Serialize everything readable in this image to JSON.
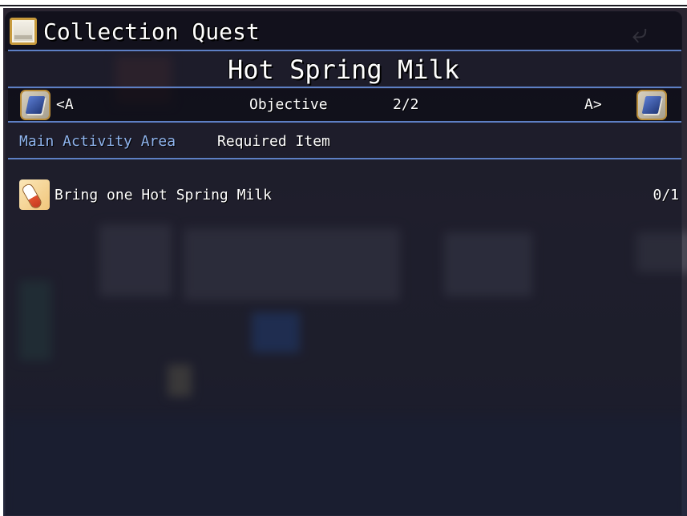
{
  "window": {
    "title": "Collection Quest",
    "title_icon": "scroll-icon",
    "back_icon": "return-arrow-icon"
  },
  "quest": {
    "name": "Hot Spring Milk"
  },
  "nav": {
    "prev_label": "<A",
    "next_label": "A>",
    "section_label": "Objective",
    "page": "2/2",
    "prev_icon": "quest-book-icon",
    "next_icon": "quest-book-icon"
  },
  "headers": {
    "area": "Main Activity Area",
    "required": "Required Item"
  },
  "items": [
    {
      "icon": "milk-bottle-icon",
      "text": "Bring one Hot Spring Milk",
      "count": "0/1"
    }
  ],
  "colors": {
    "accent_line": "#5d7fc4",
    "header_blue": "#8fb4ee",
    "text": "#ffffff",
    "icon_frame": "#c79a3c"
  }
}
